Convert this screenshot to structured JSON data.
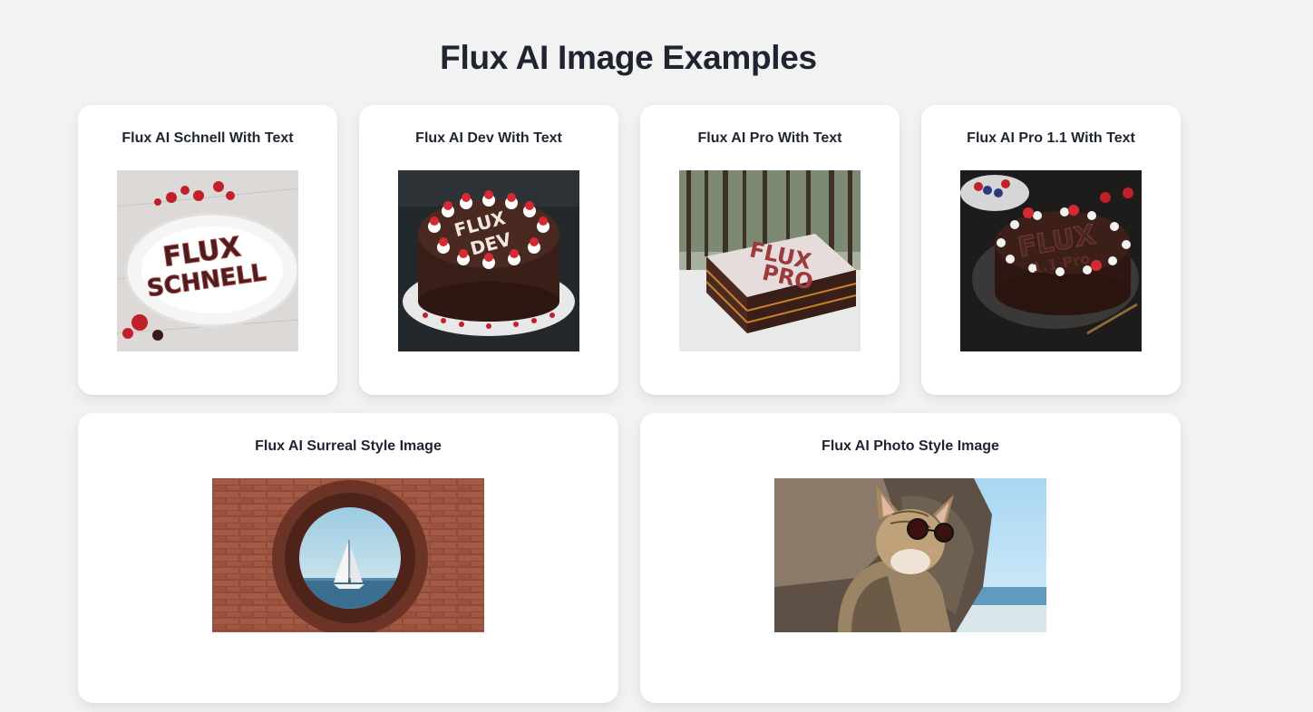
{
  "page": {
    "title": "Flux AI Image Examples"
  },
  "cards": [
    {
      "title": "Flux AI Schnell With Text",
      "image_text": [
        "FLUX",
        "SCHNELL"
      ]
    },
    {
      "title": "Flux AI Dev With Text",
      "image_text": [
        "FLUX",
        "DEV"
      ]
    },
    {
      "title": "Flux AI Pro With Text",
      "image_text": [
        "FLUX",
        "PRO"
      ]
    },
    {
      "title": "Flux AI Pro 1.1 With Text",
      "image_text": [
        "FLUX",
        "1.1 Pro"
      ]
    },
    {
      "title": "Flux AI Surreal Style Image"
    },
    {
      "title": "Flux AI Photo Style Image"
    }
  ],
  "colors": {
    "background": "#f2f2f2",
    "card": "#ffffff",
    "text": "#1f2530"
  }
}
